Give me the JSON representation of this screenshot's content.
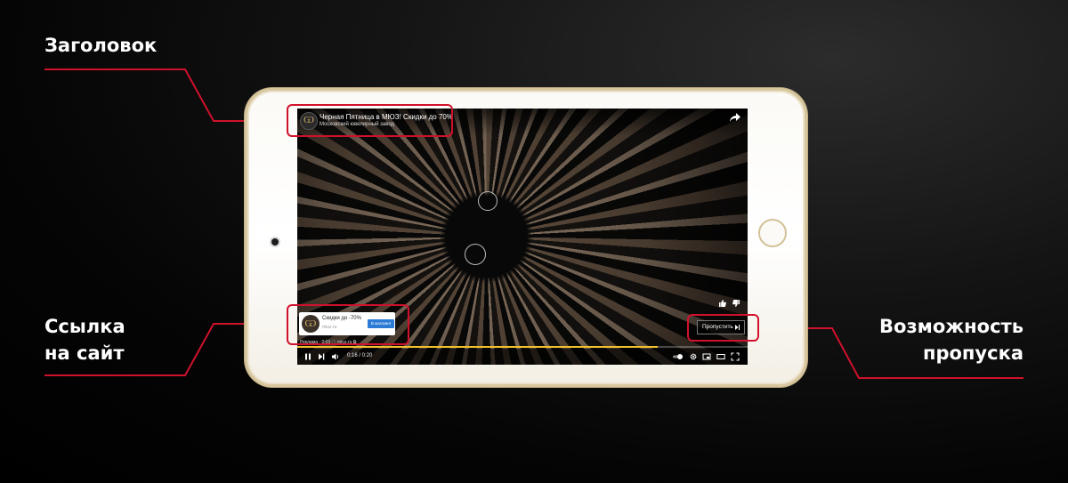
{
  "callouts": {
    "title": "Заголовок",
    "link_line1": "Ссылка",
    "link_line2": "на сайт",
    "skip_line1": "Возможность",
    "skip_line2": "пропуска"
  },
  "video": {
    "title": "Черная Пятница в МЮЗ! Скидки до 70%",
    "channel": "Московский ювелирный завод",
    "channel_logo_glyph": "Ѡ"
  },
  "ad": {
    "text": "Скидки до -70%",
    "domain": "miuz.ru",
    "cta_label": "В магазин!",
    "meta": "Реклама · 0:03  ⓘ  miuz.ru ⧉"
  },
  "skip": {
    "label": "Пропустить"
  },
  "player": {
    "time": "0:16 / 0:20",
    "progress": 0.8
  },
  "colors": {
    "callout_accent": "#d0112b",
    "progress": "#f2c12e",
    "cta": "#2a7ad6",
    "tablet_trim": "#d8c69e"
  },
  "icons": [
    "share-icon",
    "like-icon",
    "dislike-icon",
    "pause-icon",
    "next-icon",
    "volume-icon",
    "autoplay-toggle-icon",
    "settings-gear-icon",
    "miniplayer-icon",
    "theater-icon",
    "fullscreen-icon",
    "skip-next-icon"
  ]
}
